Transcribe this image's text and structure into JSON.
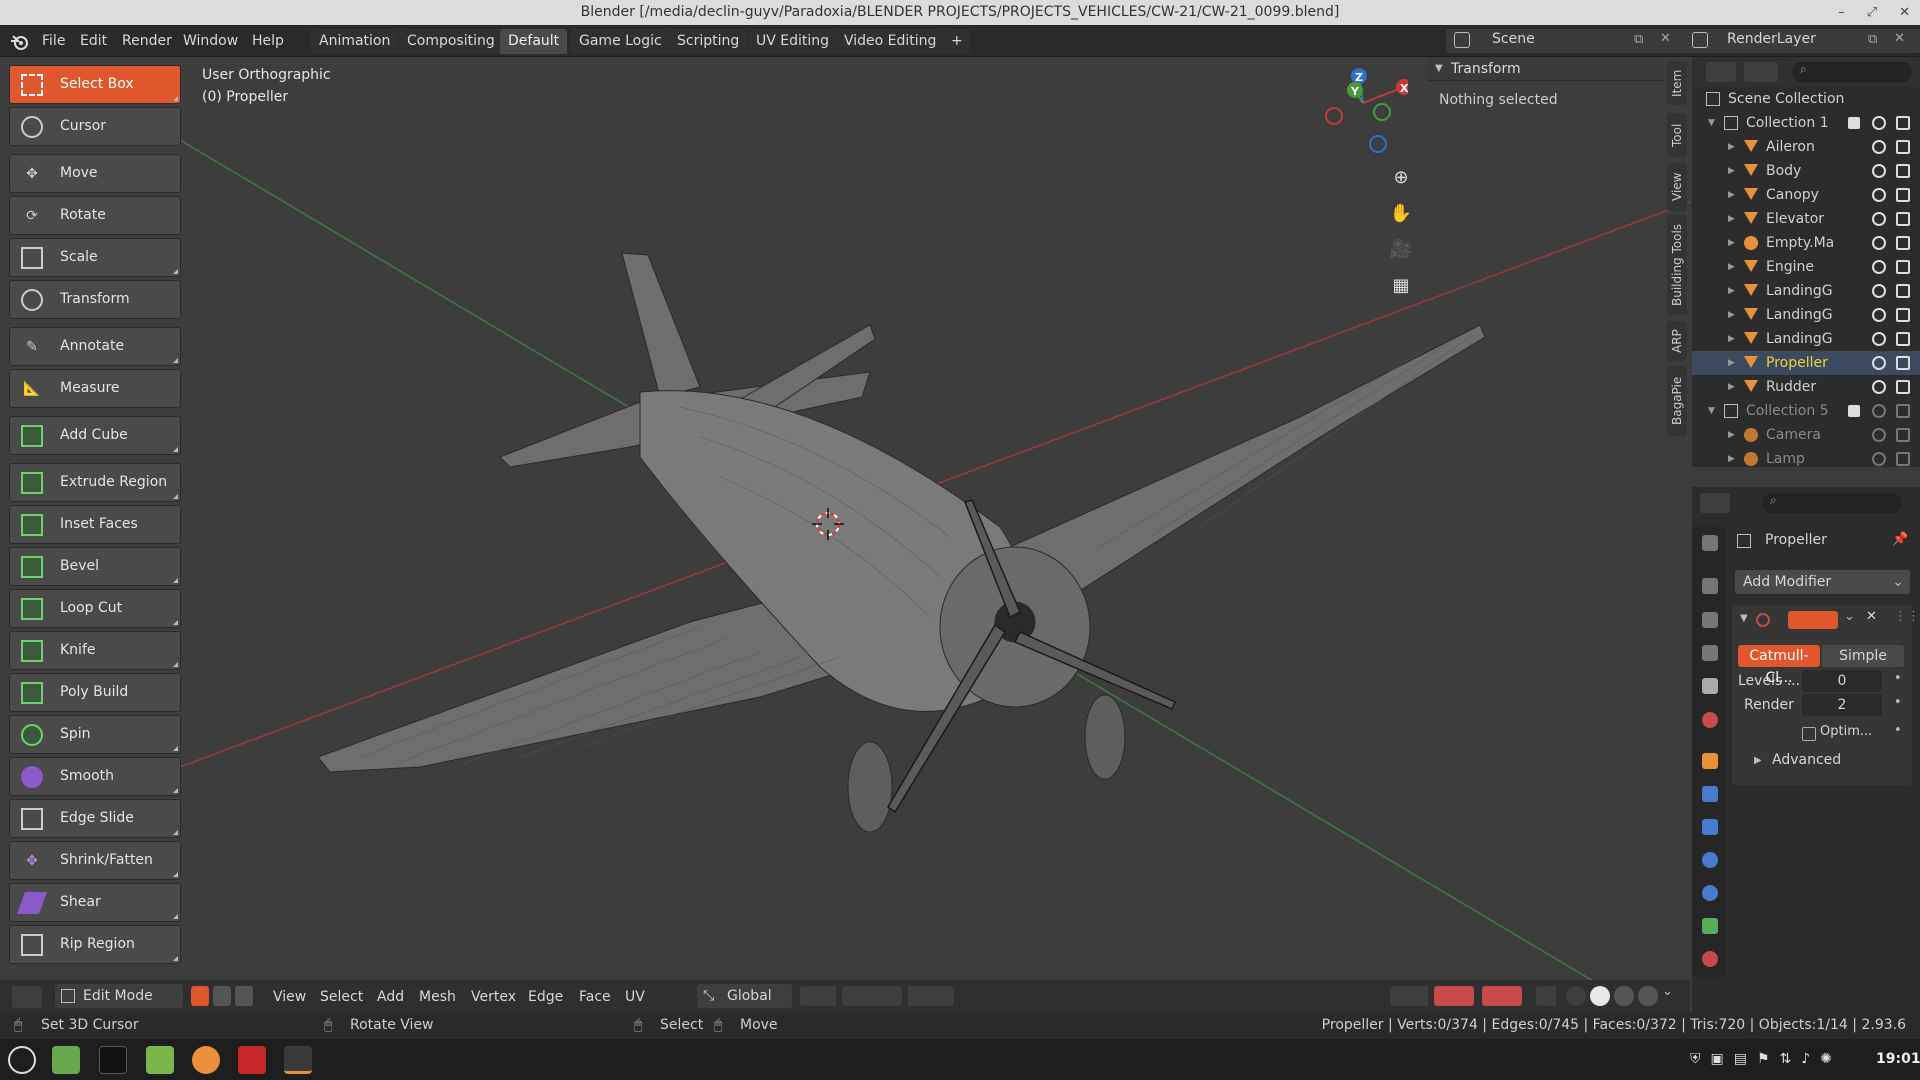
{
  "window": {
    "title": "Blender [/media/declin-guyv/Paradoxia/BLENDER PROJECTS/PROJECTS_VEHICLES/CW-21/CW-21_0099.blend]"
  },
  "menu": [
    "File",
    "Edit",
    "Render",
    "Window",
    "Help"
  ],
  "workspaces": [
    "Animation",
    "Compositing",
    "Default",
    "Game Logic",
    "Scripting",
    "UV Editing",
    "Video Editing"
  ],
  "active_workspace": "Default",
  "add_tab": "+",
  "scene": {
    "label": "Scene"
  },
  "render_layer": {
    "label": "RenderLayer"
  },
  "viewport": {
    "view_name": "User Orthographic",
    "object_name": "(0) Propeller"
  },
  "tools": [
    {
      "label": "Select Box",
      "icon": "select-box-icon"
    },
    {
      "label": "Cursor",
      "icon": "cursor-icon"
    },
    {
      "label": "Move",
      "icon": "move-icon"
    },
    {
      "label": "Rotate",
      "icon": "rotate-icon"
    },
    {
      "label": "Scale",
      "icon": "scale-icon"
    },
    {
      "label": "Transform",
      "icon": "transform-icon"
    },
    {
      "label": "Annotate",
      "icon": "annotate-icon"
    },
    {
      "label": "Measure",
      "icon": "measure-icon"
    },
    {
      "label": "Add Cube",
      "icon": "add-cube-icon"
    },
    {
      "label": "Extrude Region",
      "icon": "extrude-icon"
    },
    {
      "label": "Inset Faces",
      "icon": "inset-icon"
    },
    {
      "label": "Bevel",
      "icon": "bevel-icon"
    },
    {
      "label": "Loop Cut",
      "icon": "loop-cut-icon"
    },
    {
      "label": "Knife",
      "icon": "knife-icon"
    },
    {
      "label": "Poly Build",
      "icon": "poly-build-icon"
    },
    {
      "label": "Spin",
      "icon": "spin-icon"
    },
    {
      "label": "Smooth",
      "icon": "smooth-icon"
    },
    {
      "label": "Edge Slide",
      "icon": "edge-slide-icon"
    },
    {
      "label": "Shrink/Fatten",
      "icon": "shrink-icon"
    },
    {
      "label": "Shear",
      "icon": "shear-icon"
    },
    {
      "label": "Rip Region",
      "icon": "rip-icon"
    }
  ],
  "npanel": {
    "header": "Transform",
    "content": "Nothing selected",
    "tabs": [
      "Item",
      "Tool",
      "View",
      "Building Tools",
      "ARP",
      "BagaPie"
    ]
  },
  "gizmo": {
    "x": "X",
    "y": "Y",
    "z": "Z"
  },
  "outliner": {
    "root": "Scene Collection",
    "items": [
      {
        "label": "Collection 1",
        "type": "collection"
      },
      {
        "label": "Aileron",
        "type": "mesh"
      },
      {
        "label": "Body",
        "type": "mesh"
      },
      {
        "label": "Canopy",
        "type": "mesh"
      },
      {
        "label": "Elevator",
        "type": "mesh"
      },
      {
        "label": "Empty.Ma",
        "type": "empty"
      },
      {
        "label": "Engine",
        "type": "mesh"
      },
      {
        "label": "LandingG",
        "type": "mesh"
      },
      {
        "label": "LandingG",
        "type": "mesh"
      },
      {
        "label": "LandingG",
        "type": "mesh"
      },
      {
        "label": "Propeller",
        "type": "mesh",
        "selected": true
      },
      {
        "label": "Rudder",
        "type": "mesh"
      },
      {
        "label": "Collection 5",
        "type": "collection",
        "dim": true
      },
      {
        "label": "Camera",
        "type": "camera",
        "dim": true
      },
      {
        "label": "Lamp",
        "type": "lamp",
        "dim": true
      }
    ]
  },
  "properties": {
    "object_name": "Propeller",
    "add_modifier": "Add Modifier",
    "subdiv_type_a": "Catmull-Cl...",
    "subdiv_type_b": "Simple",
    "levels_label": "Levels ...",
    "levels_value": "0",
    "render_label": "Render",
    "render_value": "2",
    "optim_label": "Optim...",
    "advanced_label": "Advanced"
  },
  "bottom": {
    "mode": "Edit Mode",
    "menus": [
      "View",
      "Select",
      "Add",
      "Mesh",
      "Vertex",
      "Edge",
      "Face",
      "UV"
    ],
    "orientation": "Global"
  },
  "status": {
    "left1": "Set 3D Cursor",
    "left2": "Rotate View",
    "left3": "Select",
    "left4": "Move",
    "right": "Propeller | Verts:0/374 | Edges:0/745 | Faces:0/372 | Tris:720 | Objects:1/14 | 2.93.6"
  },
  "taskbar": {
    "time": "19:01"
  },
  "colors": {
    "accent": "#e0572d",
    "selected_text": "#f0d040",
    "orange_obj": "#e8903a"
  }
}
